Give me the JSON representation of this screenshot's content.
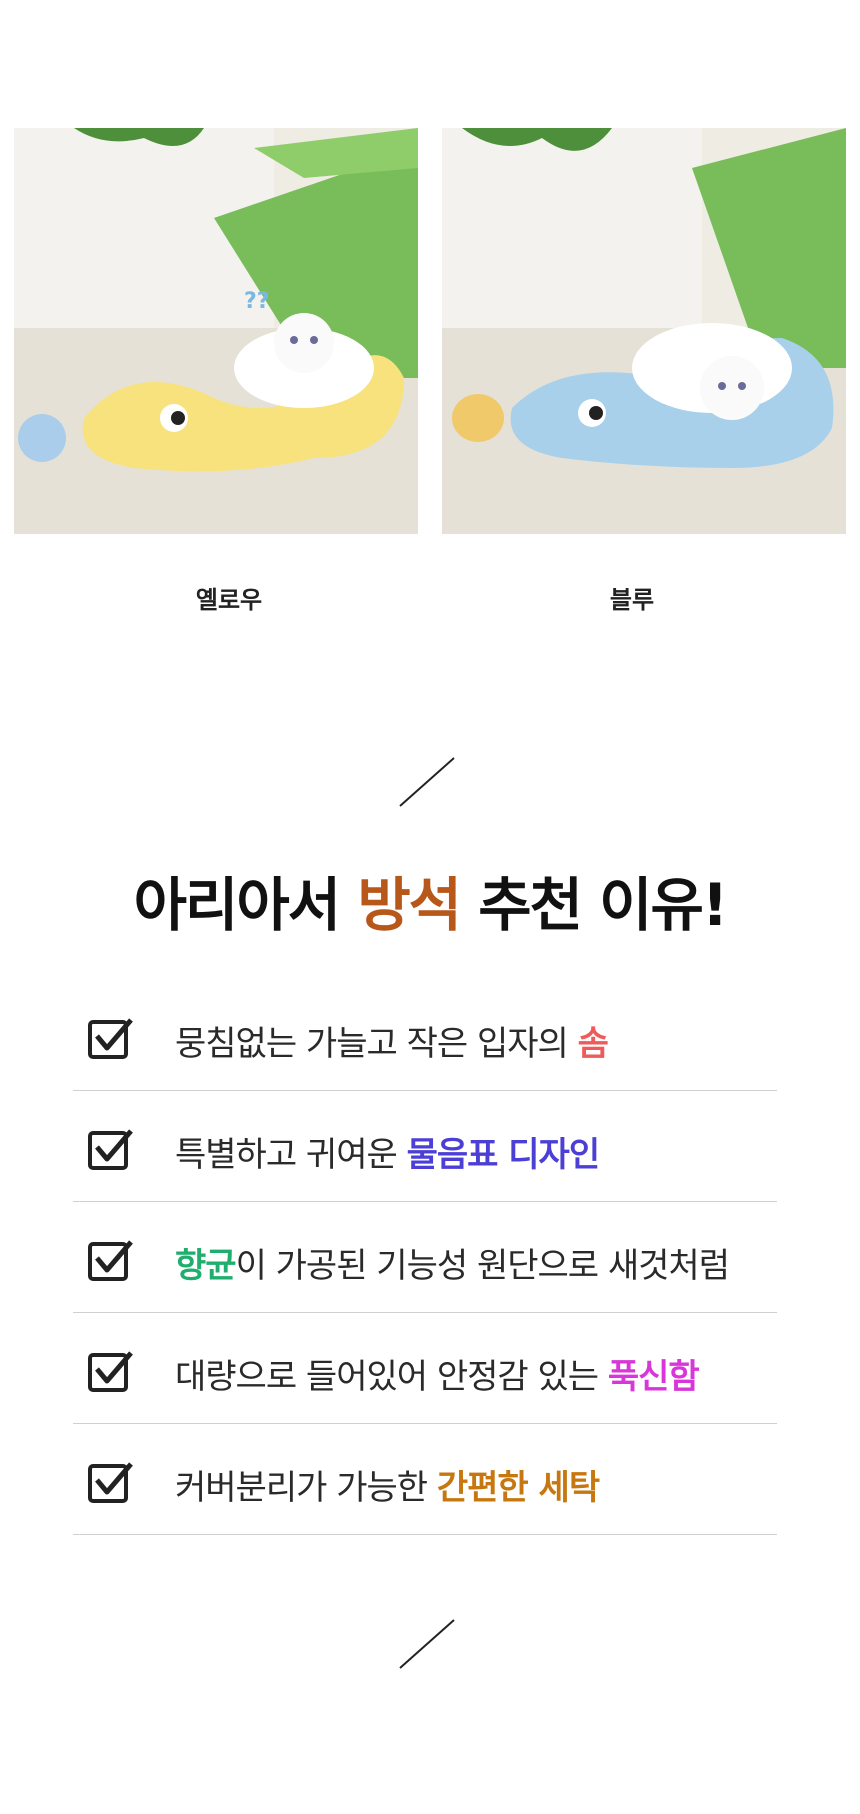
{
  "products": [
    {
      "name": "옐로우",
      "body_color": "#f7e27d",
      "accent_color": "#a9cdea"
    },
    {
      "name": "블루",
      "body_color": "#a9d0ea",
      "accent_color": "#f0c96b"
    }
  ],
  "headline": {
    "before": "아리아서 ",
    "accent": "방석",
    "after": " 추천 이유!",
    "accent_color": "#b8571a"
  },
  "reasons": [
    {
      "text": "뭉침없는 가늘고 작은 입자의 ",
      "highlight": "솜",
      "highlight_color": "#ef5a5a",
      "trailing": ""
    },
    {
      "text": "특별하고 귀여운 ",
      "highlight": "물음표 디자인",
      "highlight_color": "#4b3fd6",
      "trailing": ""
    },
    {
      "text": "",
      "highlight": "향균",
      "highlight_color": "#1fae6e",
      "trailing": "이 가공된 기능성 원단으로 새것처럼"
    },
    {
      "text": "대량으로 들어있어 안정감 있는 ",
      "highlight": "푹신함",
      "highlight_color": "#d836d8",
      "trailing": ""
    },
    {
      "text": "커버분리가 가능한 ",
      "highlight": "간편한 세탁",
      "highlight_color": "#c7770f",
      "trailing": ""
    }
  ],
  "icons": {
    "check": "checkbox-check-icon",
    "divider": "slash-divider-icon"
  }
}
